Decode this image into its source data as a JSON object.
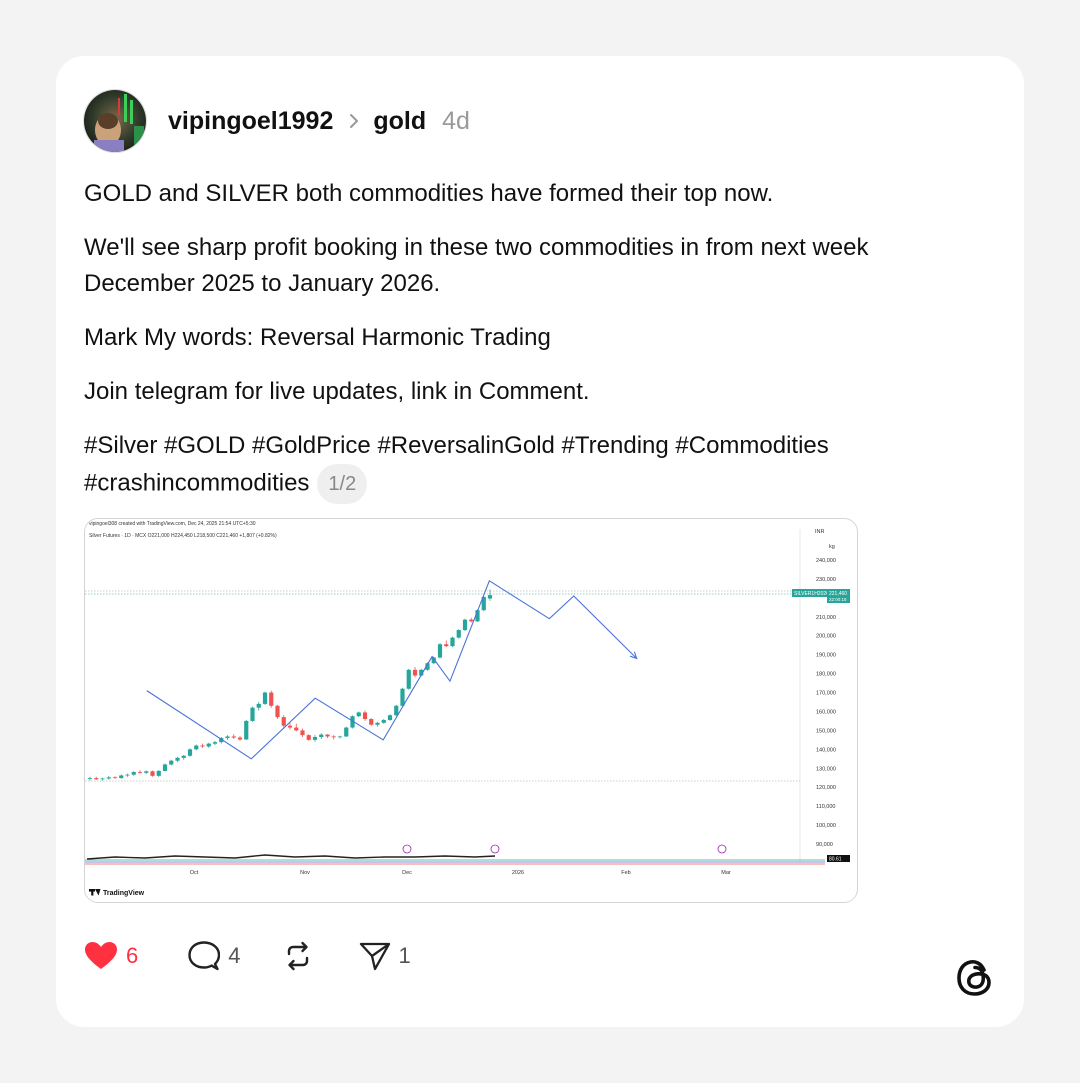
{
  "post": {
    "username": "vipingoel1992",
    "topic": "gold",
    "time": "4d",
    "paragraphs": [
      "GOLD and SILVER both commodities have formed their top now.",
      "We'll see sharp profit booking in these two commodities in from next week December 2025 to January 2026.",
      "Mark My words: Reversal Harmonic Trading",
      "Join telegram for live updates, link in Comment."
    ],
    "hashtags": "#Silver #GOLD #GoldPrice #ReversalinGold #Trending #Commodities #crashincommodities",
    "pager": "1/2"
  },
  "actions": {
    "like_count": "6",
    "comment_count": "4",
    "share_count": "1"
  },
  "chart": {
    "header_line": "vipingoel308 created with TradingView.com, Dec 24, 2025 21:54 UTC+5:30",
    "legend_line": "Silver Futures · 1D · MCX  O221,000  H224,450  L218,500  C221,460  +1,807 (+0.82%)",
    "currency": "INR",
    "unit": "kg",
    "price_tag": "SILVER1H2026",
    "price_value": "221,460",
    "price_countdown": "22:00:18",
    "osc_value": "80.61",
    "brand": "TradingView",
    "y_ticks": [
      "240,000",
      "230,000",
      "210,000",
      "200,000",
      "190,000",
      "180,000",
      "170,000",
      "160,000",
      "150,000",
      "140,000",
      "130,000",
      "120,000",
      "110,000",
      "100,000",
      "90,000"
    ],
    "x_ticks": [
      "Oct",
      "Nov",
      "Dec",
      "2026",
      "Feb",
      "Mar"
    ]
  },
  "colors": {
    "like": "#ff3040",
    "up": "#26a69a",
    "down": "#ef5350",
    "harmonic": "#4a73d9"
  },
  "chart_data": {
    "type": "candlestick",
    "series": [
      {
        "ohlc": [
          [
            124500,
            125500,
            123500,
            124800
          ],
          [
            124800,
            125500,
            123800,
            124200
          ],
          [
            124200,
            125000,
            123500,
            124600
          ],
          [
            124600,
            126000,
            124000,
            125200
          ],
          [
            125200,
            125800,
            124500,
            124800
          ],
          [
            124800,
            126800,
            124500,
            126200
          ],
          [
            126200,
            127200,
            125500,
            126600
          ],
          [
            126600,
            128500,
            126000,
            128000
          ],
          [
            128000,
            129000,
            127200,
            127600
          ],
          [
            127600,
            128800,
            127000,
            128400
          ],
          [
            128400,
            128800,
            125500,
            126000
          ],
          [
            126000,
            129000,
            125500,
            128600
          ],
          [
            128600,
            132500,
            128200,
            132000
          ],
          [
            132000,
            134500,
            131500,
            134000
          ],
          [
            134000,
            136000,
            133200,
            135500
          ],
          [
            135500,
            137000,
            134500,
            136600
          ],
          [
            136600,
            140500,
            136000,
            140000
          ],
          [
            140000,
            142500,
            139500,
            142000
          ],
          [
            142000,
            143000,
            140800,
            141500
          ],
          [
            141500,
            143500,
            140800,
            143000
          ],
          [
            143000,
            144500,
            142200,
            143800
          ],
          [
            143800,
            146500,
            143000,
            146000
          ],
          [
            146000,
            147500,
            145000,
            146800
          ],
          [
            146800,
            148000,
            145500,
            146200
          ],
          [
            146200,
            147000,
            144500,
            145200
          ],
          [
            145200,
            155500,
            145000,
            155000
          ],
          [
            155000,
            162500,
            154500,
            162000
          ],
          [
            162000,
            165000,
            160500,
            164000
          ],
          [
            164000,
            170500,
            163500,
            170000
          ],
          [
            170000,
            171000,
            162000,
            163000
          ],
          [
            163000,
            163500,
            156000,
            157000
          ],
          [
            157000,
            158000,
            151500,
            152500
          ],
          [
            152500,
            154000,
            150500,
            151500
          ],
          [
            151500,
            153500,
            149500,
            150000
          ],
          [
            150000,
            151000,
            146500,
            147500
          ],
          [
            147500,
            148000,
            144500,
            145000
          ],
          [
            145000,
            147500,
            144000,
            146500
          ],
          [
            146500,
            148500,
            145500,
            147800
          ],
          [
            147800,
            148000,
            146000,
            146800
          ],
          [
            146800,
            147500,
            145200,
            146400
          ],
          [
            146400,
            147200,
            145800,
            146800
          ],
          [
            146800,
            152000,
            146500,
            151500
          ],
          [
            151500,
            158000,
            151000,
            157500
          ],
          [
            157500,
            160000,
            157000,
            159500
          ],
          [
            159500,
            160500,
            155000,
            156000
          ],
          [
            156000,
            156500,
            152500,
            153000
          ],
          [
            153000,
            154500,
            152000,
            154000
          ],
          [
            154000,
            156000,
            153500,
            155500
          ],
          [
            155500,
            158500,
            155000,
            158000
          ],
          [
            158000,
            163500,
            157500,
            163000
          ],
          [
            163000,
            172500,
            162500,
            172000
          ],
          [
            172000,
            182500,
            171500,
            182000
          ],
          [
            182000,
            183500,
            178000,
            179000
          ],
          [
            179000,
            182500,
            178500,
            182000
          ],
          [
            182000,
            186000,
            181500,
            185500
          ],
          [
            185500,
            189000,
            185000,
            188500
          ],
          [
            188500,
            196000,
            188000,
            195500
          ],
          [
            195500,
            197500,
            194000,
            194500
          ],
          [
            194500,
            199500,
            194000,
            199000
          ],
          [
            199000,
            203500,
            198500,
            203000
          ],
          [
            203000,
            209000,
            202500,
            208500
          ],
          [
            208500,
            209500,
            207000,
            207600
          ],
          [
            207600,
            214000,
            207300,
            213500
          ],
          [
            213500,
            221000,
            213000,
            220500
          ],
          [
            219650,
            224450,
            218500,
            221460
          ]
        ]
      }
    ],
    "harmonic_path": [
      [
        "2025-09-18",
        171000
      ],
      [
        "2025-10-17",
        135000
      ],
      [
        "2025-11-04",
        167000
      ],
      [
        "2025-11-24",
        145000
      ],
      [
        "2025-12-08",
        189000
      ],
      [
        "2025-12-13",
        176000
      ],
      [
        "2025-12-24",
        229000
      ],
      [
        "2026-01-10",
        209000
      ],
      [
        "2026-01-17",
        221000
      ],
      [
        "2026-02-04",
        188000
      ]
    ]
  }
}
